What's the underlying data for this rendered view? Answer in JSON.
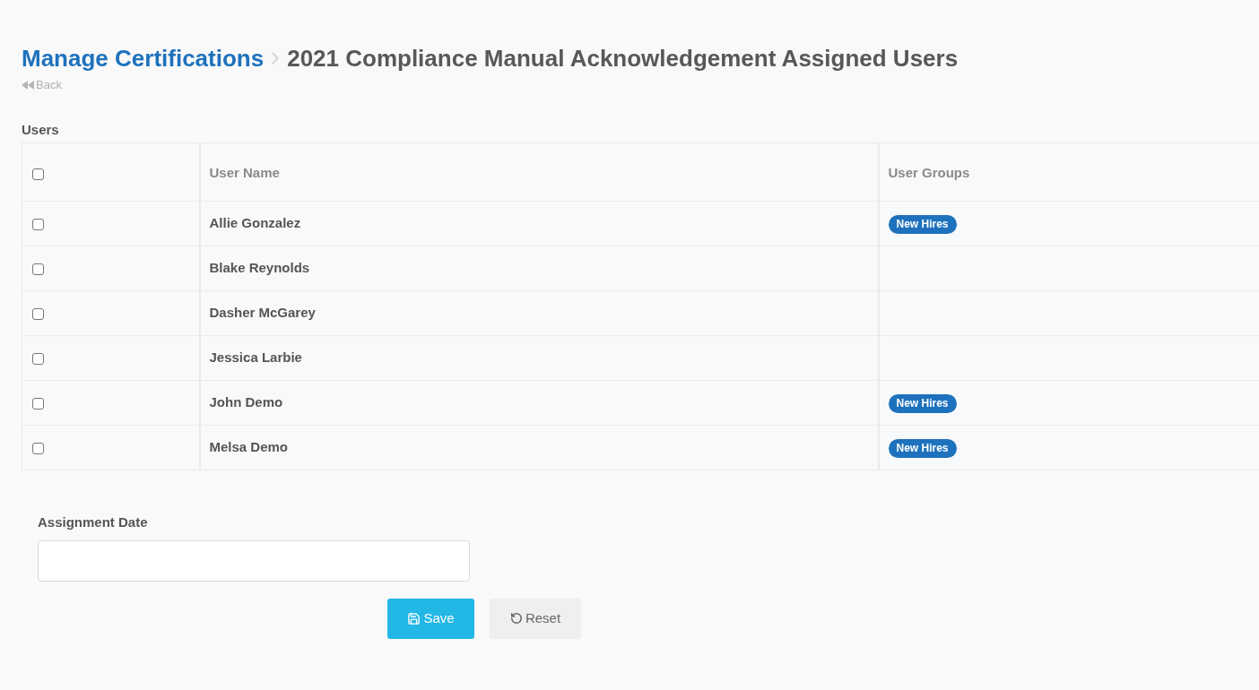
{
  "breadcrumb": {
    "link": "Manage Certifications",
    "title": "2021 Compliance Manual Acknowledgement Assigned Users"
  },
  "back_link": "Back",
  "users": {
    "heading": "Users",
    "table": {
      "select_all_checked": false,
      "columns": [
        "User Name",
        "User Groups"
      ],
      "rows": [
        {
          "checked": false,
          "user_name": "Allie Gonzalez",
          "user_groups": [
            "New Hires"
          ]
        },
        {
          "checked": false,
          "user_name": "Blake Reynolds",
          "user_groups": []
        },
        {
          "checked": false,
          "user_name": "Dasher McGarey",
          "user_groups": []
        },
        {
          "checked": false,
          "user_name": "Jessica Larbie",
          "user_groups": []
        },
        {
          "checked": false,
          "user_name": "John Demo",
          "user_groups": [
            "New Hires"
          ]
        },
        {
          "checked": false,
          "user_name": "Melsa Demo",
          "user_groups": [
            "New Hires"
          ]
        }
      ]
    }
  },
  "assignment_date": {
    "label": "Assignment Date"
  },
  "buttons": [
    {
      "kind": "primary",
      "label": "Save"
    },
    {
      "kind": "secondary",
      "label": "Reset"
    }
  ]
}
